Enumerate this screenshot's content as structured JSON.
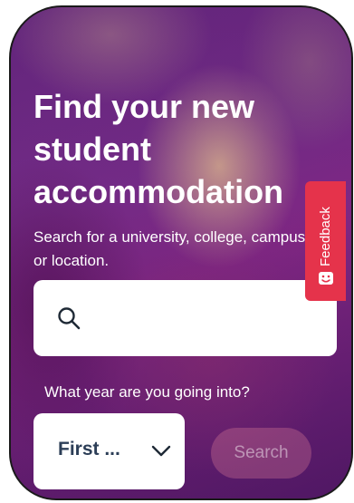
{
  "hero": {
    "headline_line1": "Find your new",
    "headline_line2": "student",
    "headline_line3": "accommodation",
    "subtitle_line1": "Search for a university, college, campus",
    "subtitle_line2": "or location."
  },
  "search": {
    "placeholder": "",
    "value": "",
    "icon": "search-icon"
  },
  "year": {
    "label": "What year are you going into?",
    "selected": "First ...",
    "icon": "chevron-down-icon"
  },
  "search_button": {
    "label": "Search"
  },
  "feedback": {
    "label": "Feedback",
    "icon": "feedback-face-icon",
    "color": "#e5334b"
  },
  "colors": {
    "text_dark": "#2c3e57",
    "overlay": "#6b2a86"
  }
}
